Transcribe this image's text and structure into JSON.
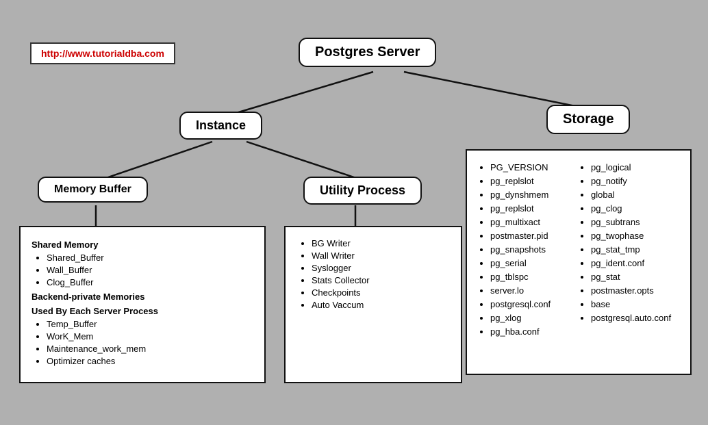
{
  "url": "http://www.tutorialdba.com",
  "nodes": {
    "postgres": "Postgres Server",
    "instance": "Instance",
    "storage": "Storage",
    "memory_buffer": "Memory Buffer",
    "utility_process": "Utility Process"
  },
  "memory_box": {
    "shared_memory_label": "Shared Memory",
    "shared_items": [
      "Shared_Buffer",
      "Wall_Buffer",
      "Clog_Buffer"
    ],
    "backend_label": "Backend-private Memories",
    "used_by_label": "Used By Each Server Process",
    "backend_items": [
      "Temp_Buffer",
      "WorK_Mem",
      "Maintenance_work_mem",
      "Optimizer caches"
    ]
  },
  "utility_box": {
    "items": [
      "BG Writer",
      "Wall Writer",
      "Syslogger",
      "Stats Collector",
      "Checkpoints",
      "Auto Vaccum"
    ]
  },
  "storage_box": {
    "col1": [
      "PG_VERSION",
      "pg_replslot",
      "pg_dynshmem",
      "pg_replslot",
      "pg_multixact",
      "postmaster.pid",
      "pg_snapshots",
      "pg_serial",
      "pg_tblspc",
      "server.lo",
      "postgresql.conf",
      "pg_xlog",
      "pg_hba.conf"
    ],
    "col2": [
      "pg_logical",
      "pg_notify",
      "global",
      "pg_clog",
      "pg_subtrans",
      "pg_twophase",
      "pg_stat_tmp",
      "pg_ident.conf",
      "pg_stat",
      "postmaster.opts",
      "base",
      "postgresql.auto.conf"
    ]
  }
}
